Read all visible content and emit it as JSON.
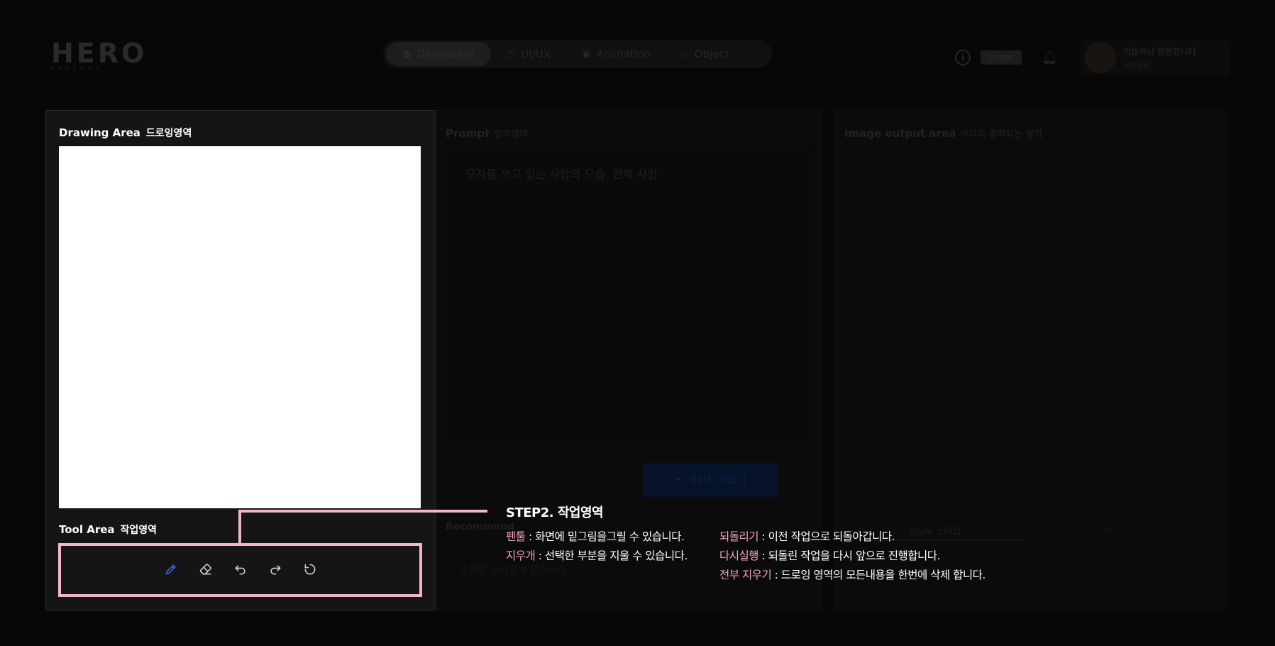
{
  "app": {
    "logo_text": "HERO",
    "logo_sub": "FACTORY"
  },
  "nav": {
    "items": [
      {
        "label": "Dashboard",
        "icon": "grid-icon"
      },
      {
        "label": "UI/UX",
        "icon": "layout-icon"
      },
      {
        "label": "Animation",
        "icon": "film-icon"
      },
      {
        "label": "Object",
        "icon": "cube-icon"
      }
    ]
  },
  "header": {
    "badge": "TOKEN",
    "user_name": "이름이님 환영합니다",
    "user_role": "일반회원"
  },
  "drawing": {
    "title": "Drawing Area",
    "title_sub": "드로잉영역"
  },
  "tools": {
    "title": "Tool Area",
    "title_sub": "작업영역",
    "items": [
      {
        "name": "pen",
        "icon": "pencil-icon",
        "active": true
      },
      {
        "name": "eraser",
        "icon": "eraser-icon",
        "active": false
      },
      {
        "name": "undo",
        "icon": "undo-icon",
        "active": false
      },
      {
        "name": "redo",
        "icon": "redo-icon",
        "active": false
      },
      {
        "name": "reset",
        "icon": "reset-icon",
        "active": false
      }
    ]
  },
  "prompt": {
    "title": "Prompt",
    "title_sub": "입력영역",
    "placeholder": "모자를 쓰고 있는 사람의 모습, 전체 사람",
    "generate_label": "이미지 만들기"
  },
  "output": {
    "title": "Image output area",
    "title_sub": "이미지 출력되는 영역"
  },
  "recommend": {
    "title": "Recommend",
    "style_tab": "Style 스타일",
    "more": "더보기",
    "empty": "추천할 스타일이 없습니다"
  },
  "tutorial": {
    "step_title": "STEP2. 작업영역",
    "left": [
      {
        "key": "펜툴",
        "text": " : 화면에 밑그림을그릴 수 있습니다."
      },
      {
        "key": "지우개",
        "text": " : 선택한 부분을 지울 수 있습니다."
      }
    ],
    "right": [
      {
        "key": "되돌리기",
        "text": " : 이전 작업으로 되돌아갑니다."
      },
      {
        "key": "다시실행",
        "text": " : 되돌린 작업을 다시 앞으로 진행합니다."
      },
      {
        "key": "전부 지우기",
        "text": " : 드로잉 영역의 모든내용을 한번에 삭제 합니다."
      }
    ]
  },
  "colors": {
    "highlight": "#f4b6c6",
    "key_text": "#f4a6bb",
    "active_tool": "#2f6df0",
    "tool_icon": "#d8d8d8",
    "panel_bg": "#151517"
  }
}
